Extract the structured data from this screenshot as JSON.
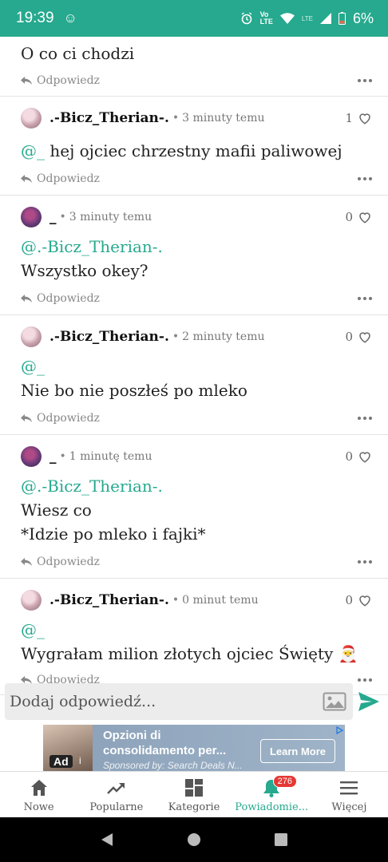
{
  "status_bar": {
    "time": "19:39",
    "network": "LTE",
    "battery": "6%"
  },
  "comments": [
    {
      "partial": true,
      "body": [
        "O co ci chodzi"
      ],
      "reply_label": "Odpowiedz"
    },
    {
      "author": ".-Bicz_Therian-.",
      "time": "3 minuty temu",
      "likes": "1",
      "mention": "@_",
      "body": [
        "hej ojciec chrzestny mafii paliwowej"
      ],
      "reply_label": "Odpowiedz"
    },
    {
      "author": "_",
      "time": "3 minuty temu",
      "likes": "0",
      "mention": "@.-Bicz_Therian-.",
      "body": [
        "Wszystko okey?"
      ],
      "reply_label": "Odpowiedz"
    },
    {
      "author": ".-Bicz_Therian-.",
      "time": "2 minuty temu",
      "likes": "0",
      "mention": "@_",
      "body": [
        "Nie bo nie poszłeś po mleko"
      ],
      "reply_label": "Odpowiedz"
    },
    {
      "author": "_",
      "time": "1 minutę temu",
      "likes": "0",
      "mention": "@.-Bicz_Therian-.",
      "body": [
        "Wiesz co",
        "*Idzie po mleko i fajki*"
      ],
      "reply_label": "Odpowiedz"
    },
    {
      "author": ".-Bicz_Therian-.",
      "time": "0 minut temu",
      "likes": "0",
      "mention": "@_",
      "body": [
        "Wygrałam milion złotych ojciec Święty 🎅"
      ],
      "reply_label": "Odpowiedz"
    }
  ],
  "composer": {
    "placeholder": "Dodaj odpowiedź..."
  },
  "ad": {
    "badge": "Ad",
    "info": "i",
    "title": "Opzioni di consolidamento per...",
    "sponsor": "Sponsored by: Search Deals N...",
    "cta": "Learn More"
  },
  "bottom_nav": [
    {
      "label": "Nowe",
      "icon": "home-icon"
    },
    {
      "label": "Popularne",
      "icon": "trending-icon"
    },
    {
      "label": "Kategorie",
      "icon": "grid-icon"
    },
    {
      "label": "Powiadomie...",
      "icon": "bell-icon",
      "badge": "276",
      "active": true
    },
    {
      "label": "Więcej",
      "icon": "menu-icon"
    }
  ],
  "colors": {
    "accent": "#26a98e",
    "badge": "#e53935"
  }
}
